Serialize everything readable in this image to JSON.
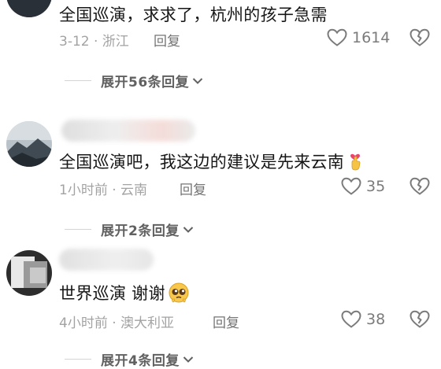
{
  "comments": [
    {
      "text": "全国巡演，求求了，杭州的孩子急需",
      "meta": "3-12 · 浙江",
      "reply": "回复",
      "likes": "1614",
      "expand": "展开56条回复"
    },
    {
      "text": "全国巡演吧，我这边的建议是先来云南",
      "meta": "1小时前 · 云南",
      "reply": "回复",
      "likes": "35",
      "expand": "展开2条回复"
    },
    {
      "text": "世界巡演 谢谢",
      "meta": "4小时前 · 澳大利亚",
      "reply": "回复",
      "likes": "38",
      "expand": "展开4条回复"
    }
  ],
  "icons": {
    "like": "heart-outline-icon",
    "dislike": "broken-heart-icon",
    "expand": "chevron-down-icon",
    "emoji_2": "heart-hand-emoji-icon",
    "emoji_3": "pleading-face-emoji-icon"
  },
  "colors": {
    "text": "#161616",
    "meta": "#a3a3a3",
    "icon": "#7b7b7b"
  }
}
